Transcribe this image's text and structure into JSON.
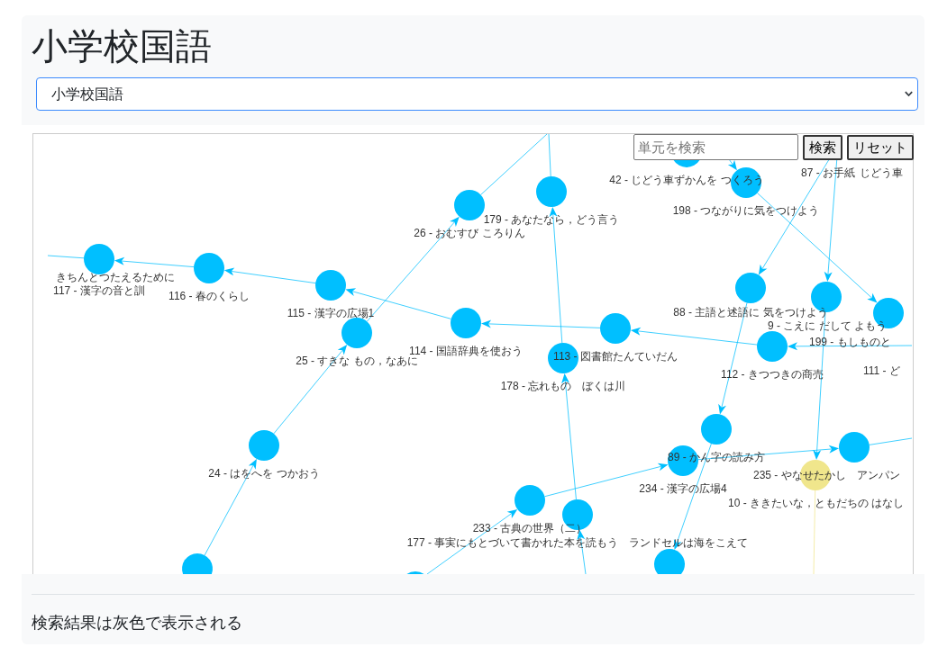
{
  "page": {
    "title": "小学校国語"
  },
  "subject_select": {
    "value": "小学校国語"
  },
  "graph": {
    "search": {
      "placeholder": "単元を検索"
    },
    "buttons": [
      "検索",
      "リセット"
    ],
    "nodes": [
      {
        "label": "42 - じどう車ずかんを つくろう",
        "color": "#00bfff"
      },
      {
        "label": "87 - お手紙"
      },
      {
        "label": "じどう車"
      },
      {
        "label": "198 - つながりに気をつけよう",
        "color": "#00bfff"
      },
      {
        "label": "26 - おむすび ころりん",
        "color": "#00bfff"
      },
      {
        "label": "179 - あなたなら，どう言う",
        "color": "#00bfff"
      },
      {
        "label": "きちんとつたえるために"
      },
      {
        "label": "117 - 漢字の音と訓",
        "color": "#00bfff"
      },
      {
        "label": "116 - 春のくらし",
        "color": "#00bfff"
      },
      {
        "label": "115 - 漢字の広場1",
        "color": "#00bfff"
      },
      {
        "label": "88 - 主語と述語に 気をつけよう",
        "color": "#00bfff"
      },
      {
        "label": "9 - こえに だして よもう",
        "color": "#00bfff"
      },
      {
        "label": "199 - もしものと",
        "color": "#00bfff"
      },
      {
        "label": "114 - 国語辞典を使おう",
        "color": "#00bfff"
      },
      {
        "label": "113 - 図書館たんていだん",
        "color": "#00bfff"
      },
      {
        "label": "25 - すきな もの，なあに",
        "color": "#00bfff"
      },
      {
        "label": "112 - きつつきの商売",
        "color": "#00bfff"
      },
      {
        "label": "178 - 忘れもの　ぼくは川",
        "color": "#00bfff"
      },
      {
        "label": "111 - ど"
      },
      {
        "label": "89 - かん字の読み方",
        "color": "#00bfff"
      },
      {
        "label": "24 - はをへを つかおう",
        "color": "#00bfff"
      },
      {
        "label": "235 - やなせたかし　アンパン",
        "color": "#00bfff"
      },
      {
        "label": "234 - 漢字の広場4",
        "color": "#00bfff"
      },
      {
        "label": "10 - ききたいな，ともだちの はなし",
        "color": "#f0e68c"
      },
      {
        "label": "233 - 古典の世界（二）",
        "color": "#00bfff"
      },
      {
        "label": "177 - 事実にもとづいて書かれた本を読もう　ランドセルは海をこえて",
        "color": "#00bfff"
      },
      {
        "color": "#00bfff"
      },
      {
        "color": "#00bfff"
      },
      {
        "color": "#00bfff"
      }
    ]
  },
  "footer": {
    "note": "検索結果は灰色で表示される"
  }
}
